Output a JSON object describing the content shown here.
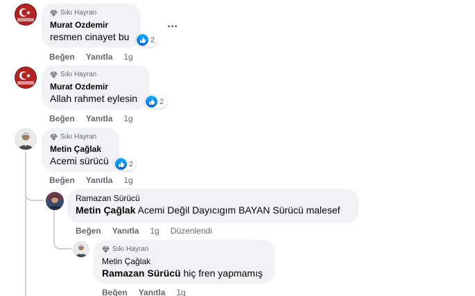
{
  "badge_label": "Sıkı Hayran",
  "comments": [
    {
      "author": "Murat Ozdemir",
      "text": "resmen cinayet bu",
      "reactions": "2",
      "actions": {
        "like": "Beğen",
        "reply": "Yanıtla",
        "time": "1g"
      }
    },
    {
      "author": "Murat Ozdemir",
      "text": "Allah rahmet eylesin",
      "reactions": "2",
      "actions": {
        "like": "Beğen",
        "reply": "Yanıtla",
        "time": "1g"
      }
    },
    {
      "author": "Metin Çağlak",
      "text": "Acemi sürücü",
      "reactions": "2",
      "actions": {
        "like": "Beğen",
        "reply": "Yanıtla",
        "time": "1g"
      },
      "replies": [
        {
          "author": "Ramazan Sürücü",
          "mention": "Metin Çağlak",
          "text": "Acemi Değil Dayıcıgım BAYAN Sürücü malesef",
          "actions": {
            "like": "Beğen",
            "reply": "Yanıtla",
            "time": "1g",
            "edited": "Düzenlendi"
          }
        },
        {
          "author": "Metin Çağlak",
          "mention": "Ramazan Sürücü",
          "text": "hiç fren yapmamış",
          "actions": {
            "like": "Beğen",
            "reply": "Yanıtla",
            "time": "1g"
          }
        }
      ]
    }
  ],
  "more_icon": "⋯",
  "colors": {
    "bubble": "#f0f2f5",
    "secondary_text": "#65676b",
    "like_blue": "#0866ff",
    "thread_line": "#ccd0d5"
  }
}
